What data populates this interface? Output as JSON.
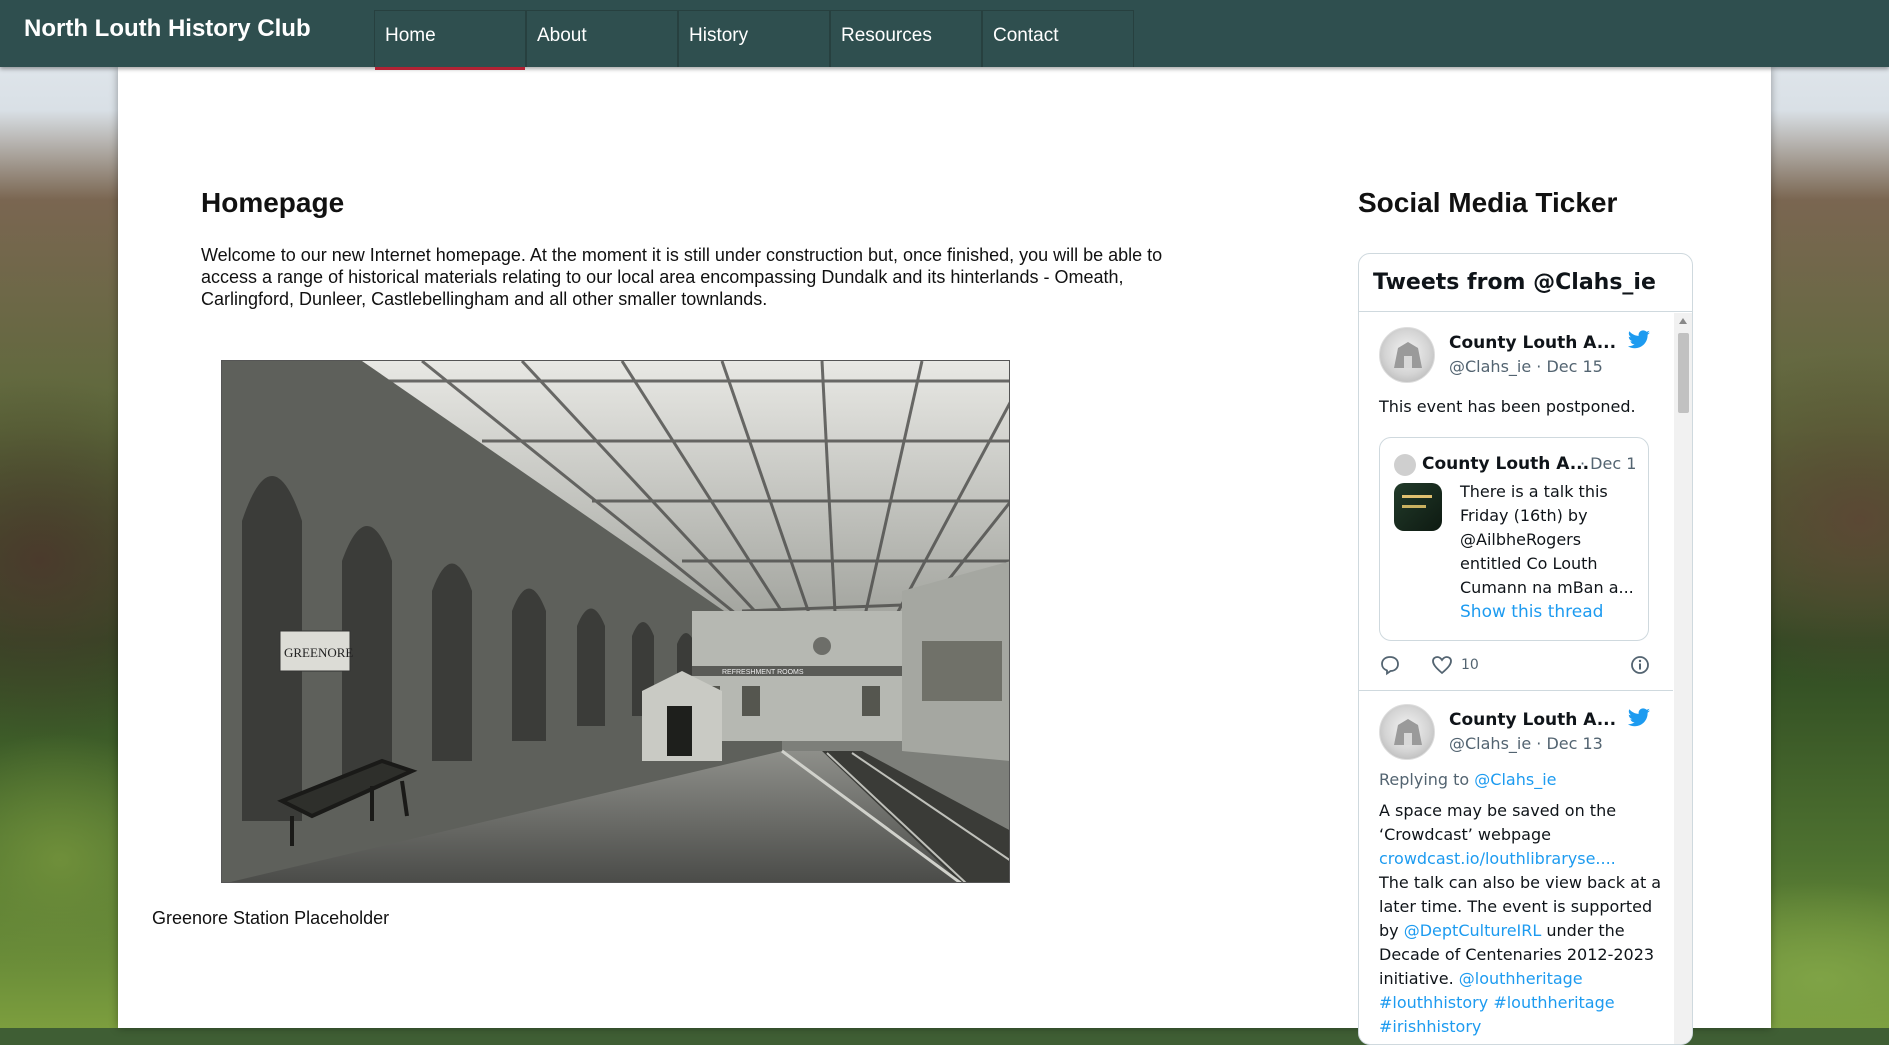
{
  "site": {
    "brand": "North Louth History Club"
  },
  "nav": [
    {
      "label": "Home",
      "active": true
    },
    {
      "label": "About",
      "active": false
    },
    {
      "label": "History",
      "active": false
    },
    {
      "label": "Resources",
      "active": false
    },
    {
      "label": "Contact",
      "active": false
    }
  ],
  "main": {
    "title": "Homepage",
    "intro": "Welcome to our new Internet homepage. At the moment it is still under construction but, once finished, you will be able to access a range of historical materials relating to our local area encompassing Dundalk and its hinterlands - Omeath, Carlingford, Dunleer, Castlebellingham and all other smaller townlands.",
    "image_caption": "Greenore Station Placeholder",
    "image_sign_text": "GREENORE",
    "image_board_text": "REFRESHMENT ROOMS"
  },
  "sidebar": {
    "title": "Social Media Ticker",
    "widget_title": "Tweets from @Clahs_ie",
    "tweets": [
      {
        "name": "County Louth A...",
        "handle": "@Clahs_ie · Dec 15",
        "text": "This event has been postponed.",
        "quote": {
          "name": "County Louth A...",
          "date": "· Dec 1",
          "text": "There is a talk this Friday (16th) by @AilbheRogers entitled Co Louth Cumann na mBan a...",
          "link": "Show this thread"
        },
        "likes": "10"
      },
      {
        "name": "County Louth A...",
        "handle": "@Clahs_ie · Dec 13",
        "reply_prefix": "Replying to ",
        "reply_to": "@Clahs_ie",
        "text_1": "A space may be saved on the ‘Crowdcast’ webpage",
        "link_1": "crowdcast.io/louthlibraryse....",
        "text_2": "The talk can also be view back at a later time. The event is supported by ",
        "mention": "@DeptCultureIRL",
        "text_3": "  under the Decade of Centenaries 2012-2023 initiative. ",
        "tags": "@louthheritage #louthhistory #louthheritage #irishhistory"
      }
    ]
  },
  "colors": {
    "nav_bg": "#2f4f4f",
    "active_underline": "#b22234",
    "twitter_blue": "#1d9bf0"
  }
}
